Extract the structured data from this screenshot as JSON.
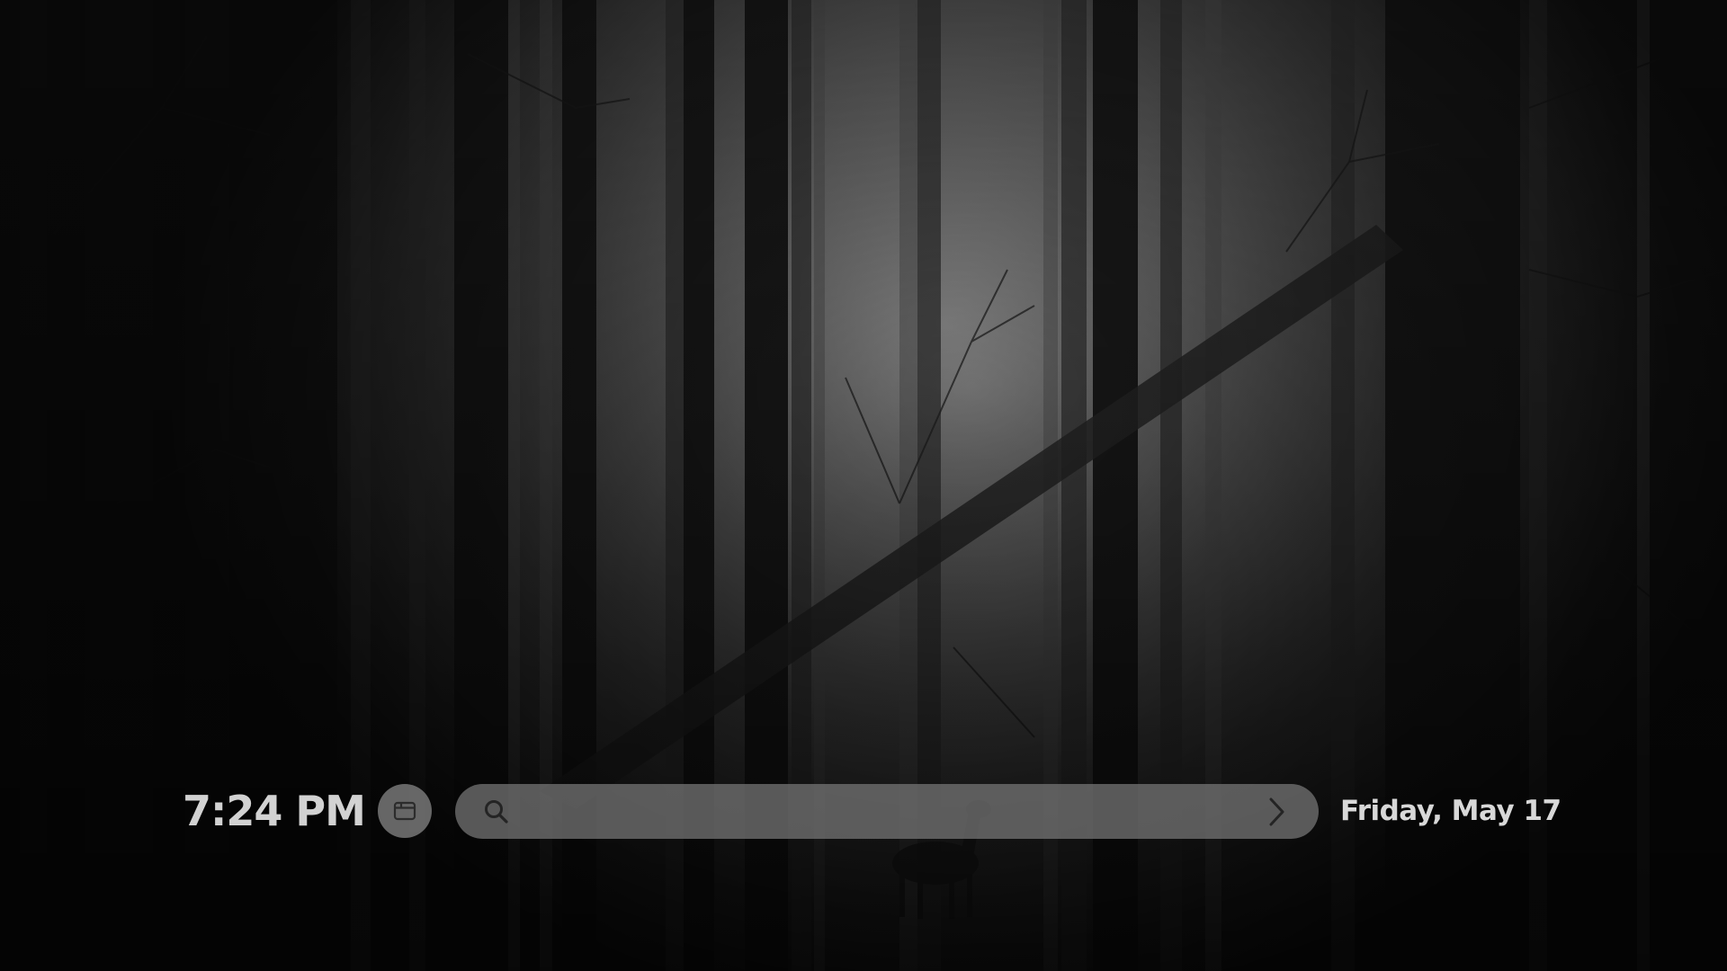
{
  "clock": {
    "time": "7:24 PM"
  },
  "date": {
    "text": "Friday, May 17"
  },
  "search": {
    "placeholder": "",
    "value": ""
  },
  "icons": {
    "window_button": "browser-window-icon",
    "search": "search-icon",
    "go": "chevron-right-icon"
  },
  "colors": {
    "text": "#d8d8d8",
    "pill_background": "#787878",
    "icon": "#2c2c2c"
  }
}
